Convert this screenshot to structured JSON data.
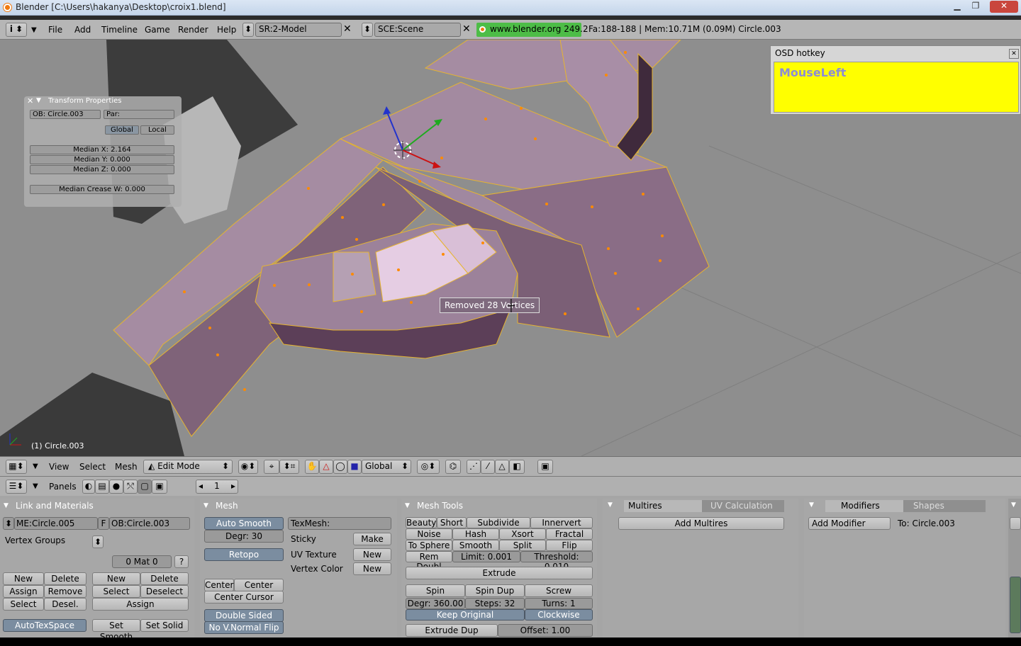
{
  "window": {
    "title": "Blender [C:\\Users\\hakanya\\Desktop\\croix1.blend]"
  },
  "menu": {
    "file": "File",
    "add": "Add",
    "timeline": "Timeline",
    "game": "Game",
    "render": "Render",
    "help": "Help"
  },
  "screen": {
    "value": "SR:2-Model"
  },
  "scene": {
    "value": "SCE:Scene"
  },
  "website": "www.blender.org 249.2",
  "stats": "Fa:188-188 | Mem:10.71M (0.09M) Circle.003",
  "osd": {
    "title": "OSD hotkey",
    "text": "MouseLeft"
  },
  "transform": {
    "title": "Transform Properties",
    "ob": "OB: Circle.003",
    "par": "Par:",
    "global": "Global",
    "local": "Local",
    "mx": "Median X: 2.164",
    "my": "Median Y: 0.000",
    "mz": "Median Z: 0.000",
    "crease": "Median Crease W: 0.000"
  },
  "viewport": {
    "status": "Removed 28 Vertices",
    "object": "(1) Circle.003"
  },
  "header3d": {
    "view": "View",
    "select": "Select",
    "mesh": "Mesh",
    "mode": "Edit Mode",
    "orient": "Global"
  },
  "buttonsheader": {
    "panels": "Panels",
    "frame": "1"
  },
  "linkmat": {
    "title": "Link and Materials",
    "me": "ME:Circle.005",
    "f": "F",
    "ob": "OB:Circle.003",
    "vgroups": "Vertex Groups",
    "mat": "0 Mat 0",
    "q": "?",
    "new1": "New",
    "delete1": "Delete",
    "assign1": "Assign",
    "remove": "Remove",
    "select1": "Select",
    "desel": "Desel.",
    "new2": "New",
    "delete2": "Delete",
    "select2": "Select",
    "deselect": "Deselect",
    "assign2": "Assign",
    "autotex": "AutoTexSpace",
    "setsmooth": "Set Smooth",
    "setsolid": "Set Solid"
  },
  "mesh": {
    "title": "Mesh",
    "autosmooth": "Auto Smooth",
    "degr": "Degr: 30",
    "retopo": "Retopo",
    "texmesh": "TexMesh:",
    "sticky": "Sticky",
    "make": "Make",
    "uvtex": "UV Texture",
    "new1": "New",
    "vcol": "Vertex Color",
    "new2": "New",
    "center": "Center",
    "centernew": "Center New",
    "centercursor": "Center Cursor",
    "doublesided": "Double Sided",
    "nonormal": "No V.Normal Flip"
  },
  "meshtools": {
    "title": "Mesh Tools",
    "beauty": "Beauty",
    "short": "Short",
    "subdivide": "Subdivide",
    "innervert": "Innervert",
    "noise": "Noise",
    "hash": "Hash",
    "xsort": "Xsort",
    "fractal": "Fractal",
    "tosphere": "To Sphere",
    "smooth": "Smooth",
    "split": "Split",
    "flipnormal": "Flip Normal",
    "remdoubl": "Rem Doubl",
    "limit": "Limit: 0.001",
    "threshold": "Threshold: 0.010",
    "extrude": "Extrude",
    "spin": "Spin",
    "spindup": "Spin Dup",
    "screw": "Screw",
    "degr": "Degr: 360.00",
    "steps": "Steps: 32",
    "turns": "Turns: 1",
    "keeporig": "Keep Original",
    "clockwise": "Clockwise",
    "extrudedup": "Extrude Dup",
    "offset": "Offset: 1.00"
  },
  "multires": {
    "tab1": "Multires",
    "tab2": "UV Calculation",
    "add": "Add Multires"
  },
  "modifiers": {
    "tab1": "Modifiers",
    "tab2": "Shapes",
    "add": "Add Modifier",
    "to": "To: Circle.003"
  },
  "colors": {
    "mesh": "#9a7e96",
    "selected": "#e8cfe6",
    "edge": "#f2b61f",
    "vert": "#ff8a00",
    "osd": "#ffff00"
  }
}
